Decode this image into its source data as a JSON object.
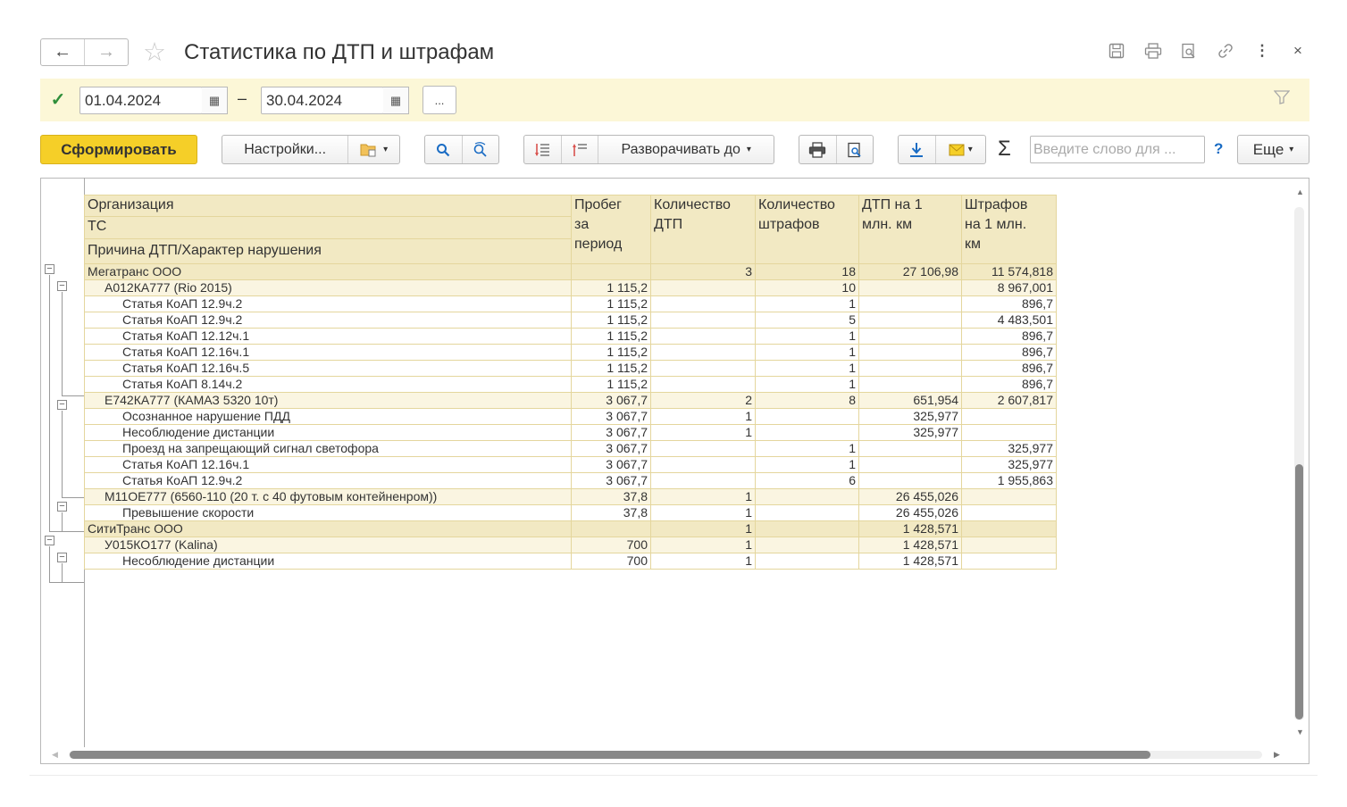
{
  "window": {
    "title": "Статистика по ДТП и штрафам",
    "back_glyph": "←",
    "forward_glyph": "→",
    "icons": [
      "floppy-icon",
      "print-icon",
      "preview-icon",
      "link-icon",
      "more-icon",
      "close-icon"
    ],
    "more_glyph": "⋮",
    "close_glyph": "×"
  },
  "filter": {
    "checked_glyph": "✓",
    "date_from": "01.04.2024",
    "date_to": "30.04.2024",
    "dash": "–",
    "more_label": "..."
  },
  "toolbar": {
    "generate_label": "Сформировать",
    "settings_label": "Настройки...",
    "expand_label": "Разворачивать до",
    "dropdown_glyph": "▾",
    "sigma": "Σ",
    "search_placeholder": "Введите слово для ...",
    "help_label": "?",
    "more_label": "Еще"
  },
  "report": {
    "headers": {
      "col1": [
        "Организация",
        "ТС",
        "Причина ДТП/Характер нарушения"
      ],
      "col2": [
        "Пробег",
        "за",
        "период"
      ],
      "col3": [
        "Количество",
        "ДТП"
      ],
      "col4": [
        "Количество",
        "штрафов"
      ],
      "col5": [
        "ДТП на 1",
        "млн. км"
      ],
      "col6": [
        "Штрафов",
        "на 1 млн.",
        "км"
      ]
    },
    "rows": [
      {
        "level": 1,
        "name": "Мегатранс ООО",
        "mileage": "",
        "accidents": "3",
        "fines": "18",
        "acc_per_mln": "27 106,98",
        "fines_per_mln": "11 574,818"
      },
      {
        "level": 2,
        "name": "А012КА777 (Rio 2015)",
        "mileage": "1 115,2",
        "accidents": "",
        "fines": "10",
        "acc_per_mln": "",
        "fines_per_mln": "8 967,001"
      },
      {
        "level": 3,
        "name": "Статья КоАП 12.9ч.2",
        "mileage": "1 115,2",
        "accidents": "",
        "fines": "1",
        "acc_per_mln": "",
        "fines_per_mln": "896,7"
      },
      {
        "level": 3,
        "name": "Статья КоАП 12.9ч.2",
        "mileage": "1 115,2",
        "accidents": "",
        "fines": "5",
        "acc_per_mln": "",
        "fines_per_mln": "4 483,501"
      },
      {
        "level": 3,
        "name": "Статья КоАП 12.12ч.1",
        "mileage": "1 115,2",
        "accidents": "",
        "fines": "1",
        "acc_per_mln": "",
        "fines_per_mln": "896,7"
      },
      {
        "level": 3,
        "name": "Статья КоАП 12.16ч.1",
        "mileage": "1 115,2",
        "accidents": "",
        "fines": "1",
        "acc_per_mln": "",
        "fines_per_mln": "896,7"
      },
      {
        "level": 3,
        "name": "Статья КоАП 12.16ч.5",
        "mileage": "1 115,2",
        "accidents": "",
        "fines": "1",
        "acc_per_mln": "",
        "fines_per_mln": "896,7"
      },
      {
        "level": 3,
        "name": "Статья КоАП 8.14ч.2",
        "mileage": "1 115,2",
        "accidents": "",
        "fines": "1",
        "acc_per_mln": "",
        "fines_per_mln": "896,7"
      },
      {
        "level": 2,
        "name": "Е742КА777 (КАМАЗ 5320 10т)",
        "mileage": "3 067,7",
        "accidents": "2",
        "fines": "8",
        "acc_per_mln": "651,954",
        "fines_per_mln": "2 607,817"
      },
      {
        "level": 3,
        "name": "Осознанное нарушение ПДД",
        "mileage": "3 067,7",
        "accidents": "1",
        "fines": "",
        "acc_per_mln": "325,977",
        "fines_per_mln": ""
      },
      {
        "level": 3,
        "name": "Несоблюдение дистанции",
        "mileage": "3 067,7",
        "accidents": "1",
        "fines": "",
        "acc_per_mln": "325,977",
        "fines_per_mln": ""
      },
      {
        "level": 3,
        "name": "Проезд на запрещающий сигнал светофора",
        "mileage": "3 067,7",
        "accidents": "",
        "fines": "1",
        "acc_per_mln": "",
        "fines_per_mln": "325,977"
      },
      {
        "level": 3,
        "name": "Статья КоАП 12.16ч.1",
        "mileage": "3 067,7",
        "accidents": "",
        "fines": "1",
        "acc_per_mln": "",
        "fines_per_mln": "325,977"
      },
      {
        "level": 3,
        "name": "Статья КоАП 12.9ч.2",
        "mileage": "3 067,7",
        "accidents": "",
        "fines": "6",
        "acc_per_mln": "",
        "fines_per_mln": "1 955,863"
      },
      {
        "level": 2,
        "name": "М11ОЕ777 (6560-110 (20 т. с 40 футовым контейненром))",
        "mileage": "37,8",
        "accidents": "1",
        "fines": "",
        "acc_per_mln": "26 455,026",
        "fines_per_mln": ""
      },
      {
        "level": 3,
        "name": "Превышение скорости",
        "mileage": "37,8",
        "accidents": "1",
        "fines": "",
        "acc_per_mln": "26 455,026",
        "fines_per_mln": ""
      },
      {
        "level": 1,
        "name": "СитиТранс ООО",
        "mileage": "",
        "accidents": "1",
        "fines": "",
        "acc_per_mln": "1 428,571",
        "fines_per_mln": ""
      },
      {
        "level": 2,
        "name": "У015КО177 (Kalina)",
        "mileage": "700",
        "accidents": "1",
        "fines": "",
        "acc_per_mln": "1 428,571",
        "fines_per_mln": ""
      },
      {
        "level": 3,
        "name": "Несоблюдение дистанции",
        "mileage": "700",
        "accidents": "1",
        "fines": "",
        "acc_per_mln": "1 428,571",
        "fines_per_mln": ""
      }
    ]
  },
  "colors": {
    "primary_button": "#f5cf28",
    "filter_bar": "#fcf7d7",
    "header_bg": "#f2e9c3",
    "group2_bg": "#faf5e1",
    "grid_border": "#e4d69d",
    "check": "#2f8f3a"
  }
}
